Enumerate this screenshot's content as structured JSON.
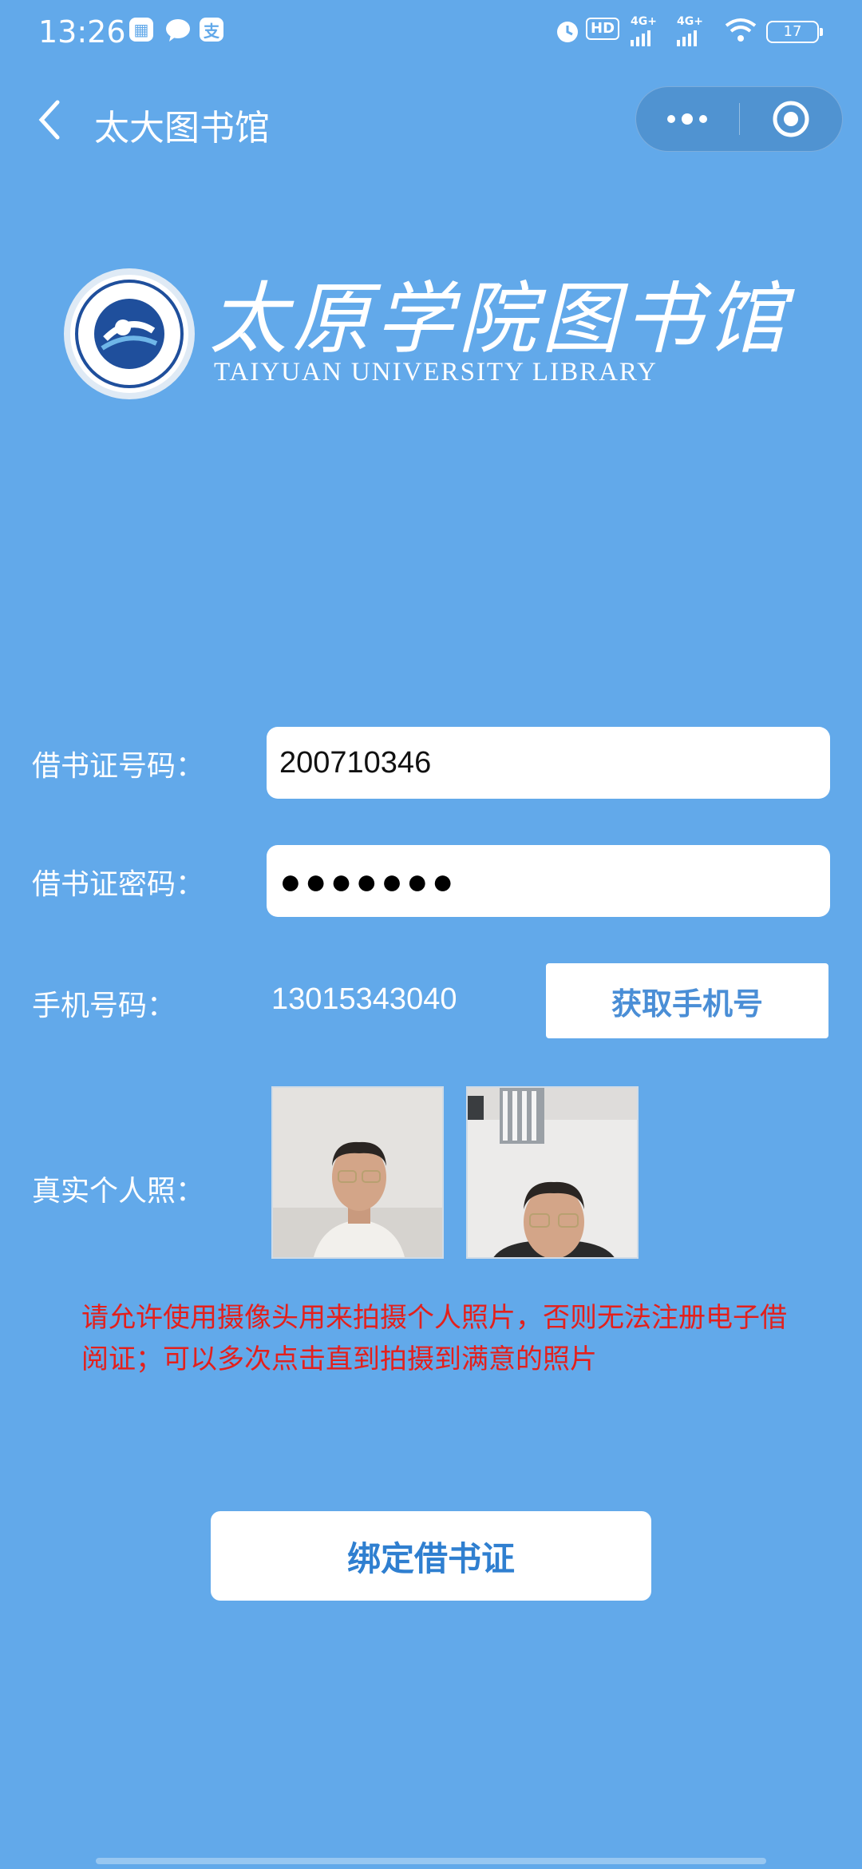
{
  "status_bar": {
    "time": "13:26",
    "left_icons": [
      "app-icon",
      "chat-icon",
      "alipay-icon"
    ],
    "hd_label": "HD",
    "signal_label": "4G+",
    "battery": "17"
  },
  "nav": {
    "title": "太大图书馆",
    "menu_icon": "more-dots-icon",
    "close_icon": "target-close-icon"
  },
  "logo": {
    "cn": "太原学院图书馆",
    "en": "TAIYUAN UNIVERSITY LIBRARY"
  },
  "form": {
    "card_number_label": "借书证号码：",
    "card_number_value": "200710346",
    "password_label": "借书证密码：",
    "password_value": "●●●●●●●",
    "phone_label": "手机号码：",
    "phone_value": "13015343040",
    "get_phone_button": "获取手机号",
    "photo_label": "真实个人照："
  },
  "notice": "请允许使用摄像头用来拍摄个人照片，否则无法注册电子借阅证；可以多次点击直到拍摄到满意的照片",
  "bind_button": "绑定借书证",
  "colors": {
    "background": "#62a9ea",
    "notice": "#e3201c",
    "button_text": "#2f7fd0"
  }
}
